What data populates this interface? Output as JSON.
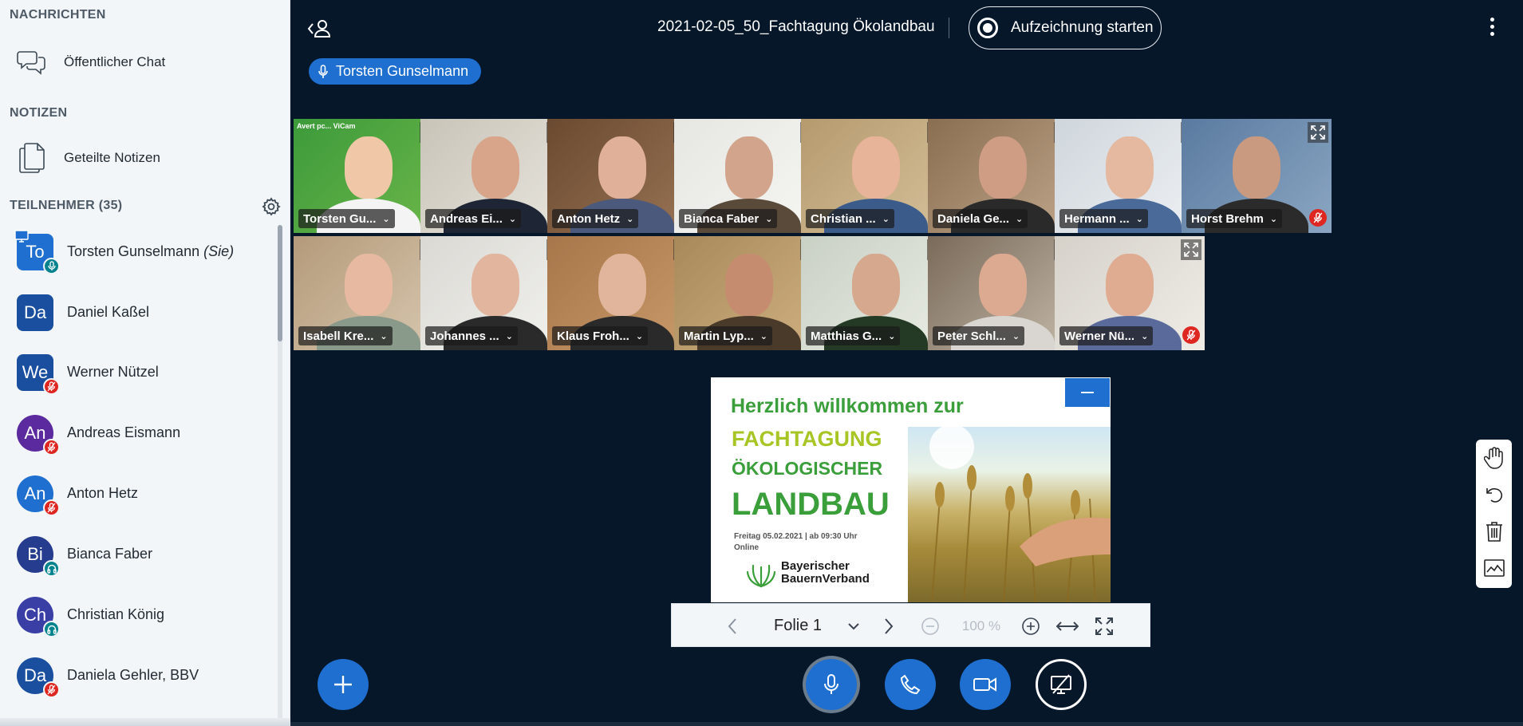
{
  "sidebar": {
    "messages_title": "NACHRICHTEN",
    "public_chat": "Öffentlicher Chat",
    "notes_title": "NOTIZEN",
    "shared_notes": "Geteilte Notizen",
    "participants_title": "TEILNEHMER (35)",
    "users": [
      {
        "initials": "To",
        "name": "Torsten Gunselmann",
        "suffix": "(Sie)",
        "status": "mic",
        "color": "#1e6fd0"
      },
      {
        "initials": "Da",
        "name": "Daniel Kaßel",
        "status": "none",
        "color": "#1a4fa0"
      },
      {
        "initials": "We",
        "name": "Werner Nützel",
        "status": "muted",
        "color": "#1a4fa0"
      },
      {
        "initials": "An",
        "name": "Andreas Eismann",
        "status": "muted",
        "color": "#5b2a9e"
      },
      {
        "initials": "An",
        "name": "Anton Hetz",
        "status": "muted",
        "color": "#1e6fd0"
      },
      {
        "initials": "Bi",
        "name": "Bianca Faber",
        "status": "listen",
        "color": "#263c8e"
      },
      {
        "initials": "Ch",
        "name": "Christian König",
        "status": "listen",
        "color": "#3a3fa6"
      },
      {
        "initials": "Da",
        "name": "Daniela Gehler, BBV",
        "status": "muted",
        "color": "#1a4fa0"
      }
    ]
  },
  "header": {
    "meeting_title": "2021-02-05_50_Fachtagung Ökolandbau",
    "record_label": "Aufzeichnung starten",
    "talking_indicator": "Torsten Gunselmann"
  },
  "videos": [
    {
      "name": "Torsten Gu...",
      "status": "none",
      "active": true
    },
    {
      "name": "Andreas Ei...",
      "status": "muted"
    },
    {
      "name": "Anton Hetz",
      "status": "muted"
    },
    {
      "name": "Bianca Faber",
      "status": "listen"
    },
    {
      "name": "Christian ...",
      "status": "listen"
    },
    {
      "name": "Daniela Ge...",
      "status": "muted"
    },
    {
      "name": "Hermann ...",
      "status": "muted"
    },
    {
      "name": "Horst Brehm",
      "status": "muted"
    },
    {
      "name": "Isabell Kre...",
      "status": "muted"
    },
    {
      "name": "Johannes ...",
      "status": "listen"
    },
    {
      "name": "Klaus Froh...",
      "status": "listen"
    },
    {
      "name": "Martin Lyp...",
      "status": "muted"
    },
    {
      "name": "Matthias G...",
      "status": "muted"
    },
    {
      "name": "Peter Schl...",
      "status": "muted"
    },
    {
      "name": "Werner Nü...",
      "status": "muted"
    }
  ],
  "first_tile_overlay": "Avert pc... ViCam",
  "slide": {
    "title": "Herzlich willkommen zur",
    "line1": "FACHTAGUNG",
    "line2": "ÖKOLOGISCHER",
    "line3": "LANDBAU",
    "date": "Freitag 05.02.2021 | ab 09:30 Uhr\nOnline",
    "logo_text": "Bayerischer\nBauernVerband"
  },
  "presentation_toolbar": {
    "slide_label": "Folie 1",
    "zoom": "100 %"
  },
  "colors": {
    "main_bg": "#06172a",
    "accent": "#1e6fd0",
    "muted_red": "#df2721",
    "listen_teal": "#00838f"
  }
}
